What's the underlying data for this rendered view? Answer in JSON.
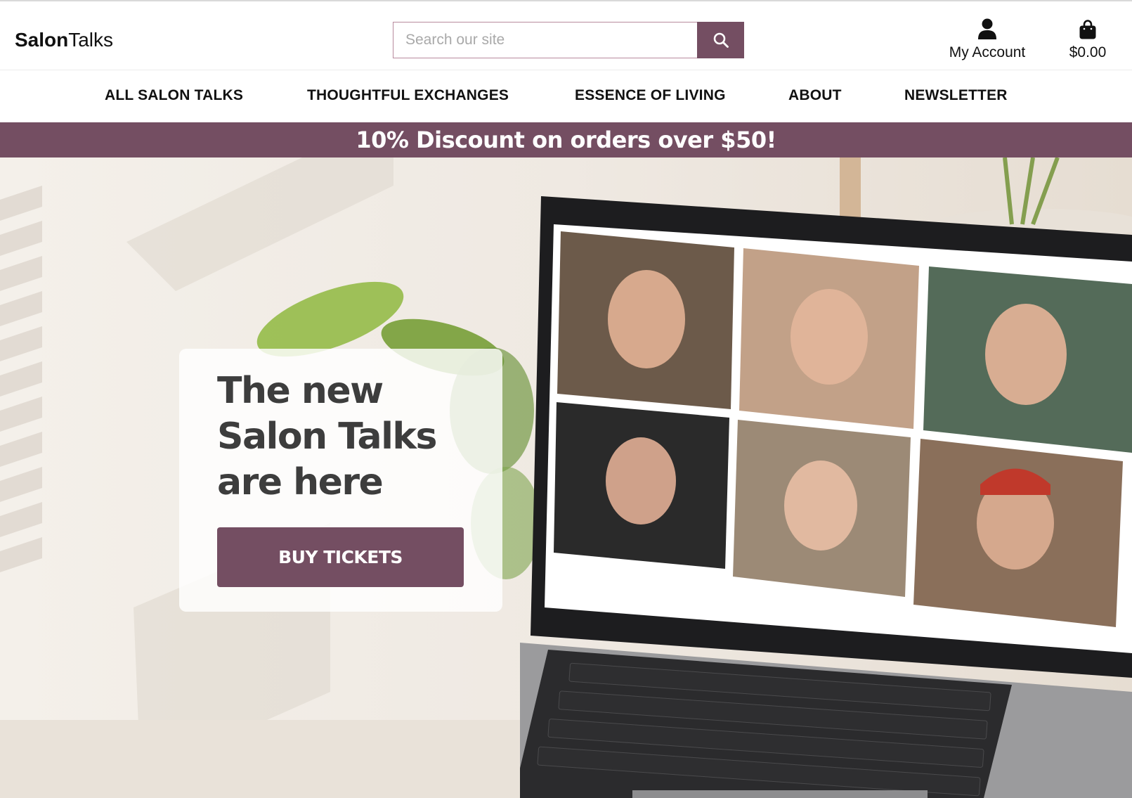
{
  "header": {
    "logo_bold": "Salon",
    "logo_regular": "Talks",
    "search_placeholder": "Search our site",
    "account_label": "My Account",
    "cart_total": "$0.00"
  },
  "nav": {
    "items": [
      {
        "label": "ALL SALON TALKS"
      },
      {
        "label": "THOUGHTFUL EXCHANGES"
      },
      {
        "label": "ESSENCE OF LIVING"
      },
      {
        "label": "ABOUT"
      },
      {
        "label": "NEWSLETTER"
      }
    ]
  },
  "promo": {
    "text": "10% Discount on orders over $50!"
  },
  "hero": {
    "title_line1": "The new",
    "title_line2": "Salon Talks",
    "title_line3": "are here",
    "cta_label": "BUY TICKETS"
  },
  "icons": {
    "search": "search-icon",
    "account": "user-icon",
    "cart": "shopping-bag-icon"
  },
  "colors": {
    "brand": "#744e62",
    "text_dark": "#3d3d3d",
    "white": "#ffffff"
  }
}
